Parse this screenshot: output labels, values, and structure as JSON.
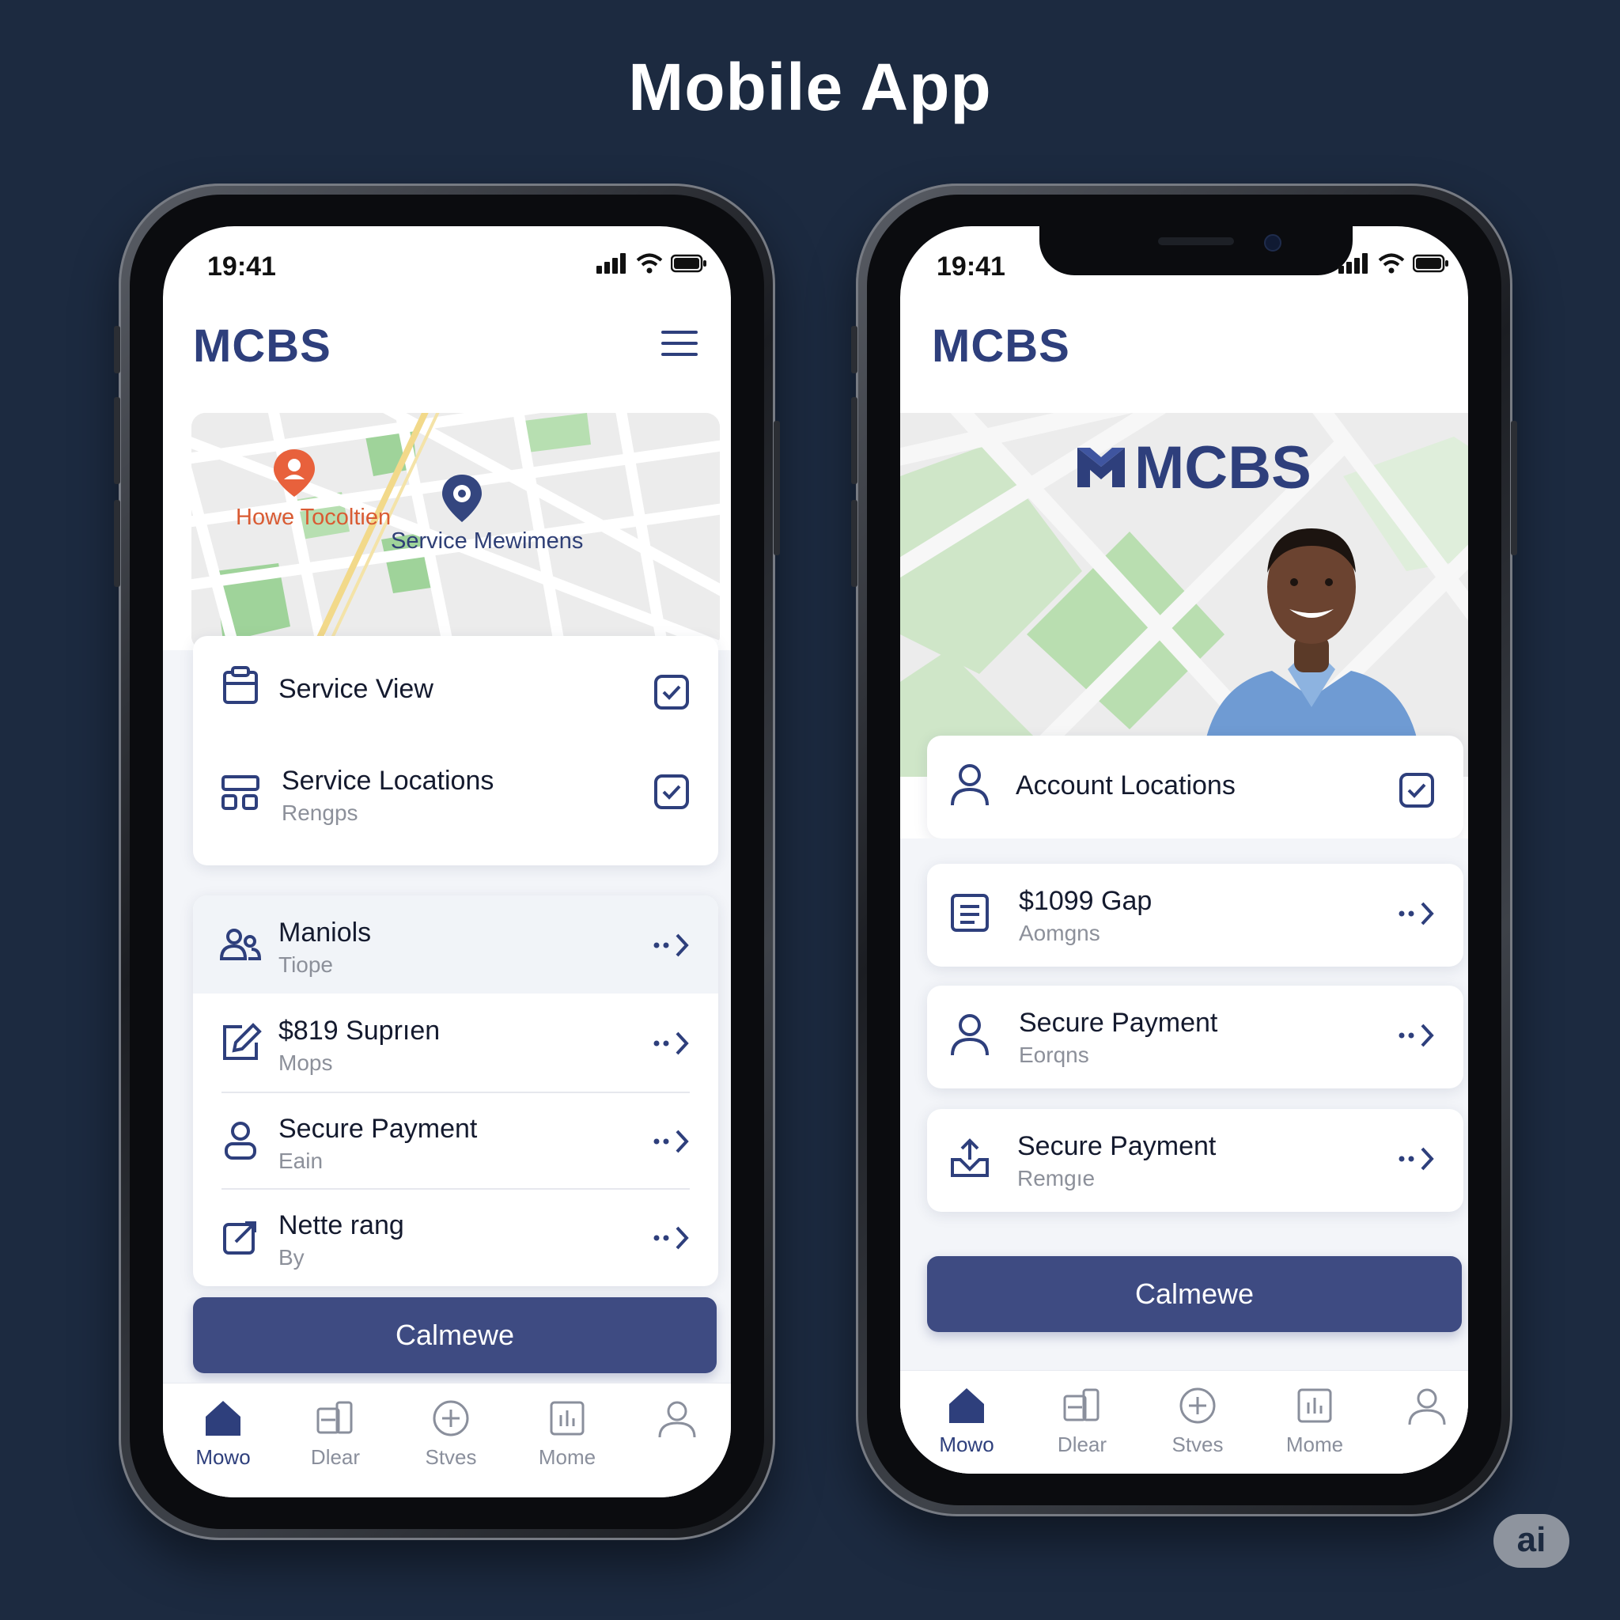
{
  "page": {
    "title": "Mobile App"
  },
  "left": {
    "status": {
      "time": "19:41"
    },
    "brand": "MCBS",
    "map": {
      "pin_home_label": "Howe Tocoltien",
      "pin_service_label": "Service Mewimens"
    },
    "top_card": [
      {
        "title": "Service View",
        "subtitle": "",
        "icon": "clipboard-icon",
        "action": "checkbox"
      },
      {
        "title": "Service Locations",
        "subtitle": "Rengps",
        "icon": "grid-icon",
        "action": "checkbox"
      }
    ],
    "list": [
      {
        "title": "Maniols",
        "subtitle": "Tiope",
        "icon": "users-icon"
      },
      {
        "title": "$819 Suprıen",
        "subtitle": "Mops",
        "icon": "edit-icon"
      },
      {
        "title": "Secure Payment",
        "subtitle": "Eain",
        "icon": "user-icon"
      },
      {
        "title": "Nette rang",
        "subtitle": "By",
        "icon": "share-icon"
      }
    ],
    "cta": "Calmewe",
    "tabs": [
      {
        "label": "Mowo",
        "icon": "home-icon",
        "active": true
      },
      {
        "label": "Dlear",
        "icon": "cards-icon",
        "active": false
      },
      {
        "label": "Stves",
        "icon": "plus-circle-icon",
        "active": false
      },
      {
        "label": "Mome",
        "icon": "chart-icon",
        "active": false
      },
      {
        "label": "",
        "icon": "profile-icon",
        "active": false
      }
    ]
  },
  "right": {
    "status": {
      "time": "19:41"
    },
    "brand": "MCBS",
    "hero_logo": "MCBS",
    "account_card": {
      "title": "Account Locations",
      "icon": "user-icon",
      "action": "checkbox"
    },
    "list": [
      {
        "title": "$1099 Gap",
        "subtitle": "Aomgns",
        "icon": "document-icon"
      },
      {
        "title": "Secure Payment",
        "subtitle": "Eorqns",
        "icon": "user-icon"
      },
      {
        "title": "Secure Payment",
        "subtitle": "Remgıe",
        "icon": "upload-tray-icon"
      }
    ],
    "cta": "Calmewe",
    "tabs": [
      {
        "label": "Mowo",
        "icon": "home-icon",
        "active": true
      },
      {
        "label": "Dlear",
        "icon": "cards-icon",
        "active": false
      },
      {
        "label": "Stves",
        "icon": "plus-circle-icon",
        "active": false
      },
      {
        "label": "Mome",
        "icon": "chart-icon",
        "active": false
      },
      {
        "label": "",
        "icon": "profile-icon",
        "active": false
      }
    ]
  },
  "badge": "ai",
  "colors": {
    "background": "#1c2a40",
    "brand": "#2e3f7c",
    "button": "#3e4b82",
    "pin_home": "#e8613c",
    "pin_service": "#34467f"
  }
}
